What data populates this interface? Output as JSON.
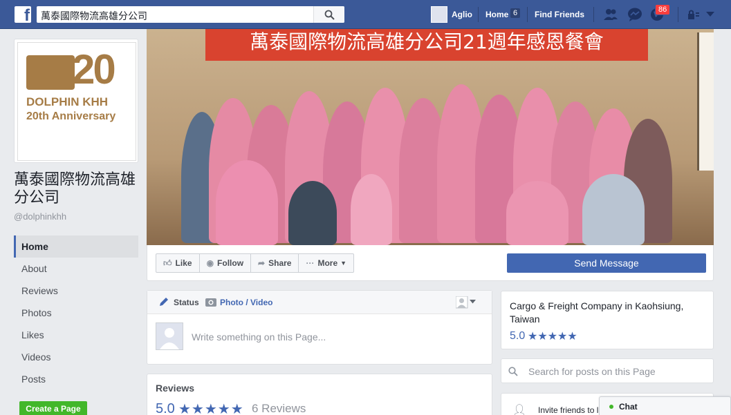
{
  "topbar": {
    "search_value": "萬泰國際物流高雄分公司",
    "user_name": "Aglio",
    "home_label": "Home",
    "home_count": "6",
    "find_friends_label": "Find Friends",
    "notifications_count": "86",
    "brand_color": "#3b5998"
  },
  "page": {
    "name": "萬泰國際物流高雄分公司",
    "handle": "@dolphinkhh",
    "logo_number": "20",
    "logo_line1": "DOLPHIN KHH",
    "logo_line2": "20th Anniversary"
  },
  "nav": {
    "items": [
      "Home",
      "About",
      "Reviews",
      "Photos",
      "Likes",
      "Videos",
      "Posts"
    ],
    "active": "Home",
    "create_page_label": "Create a Page"
  },
  "cover": {
    "banner_text": "萬泰國際物流高雄分公司21週年感恩餐會"
  },
  "actions": {
    "like_label": "Like",
    "follow_label": "Follow",
    "share_label": "Share",
    "more_label": "More",
    "send_message_label": "Send Message"
  },
  "composer": {
    "status_tab": "Status",
    "photo_tab": "Photo / Video",
    "placeholder": "Write something on this Page..."
  },
  "reviews": {
    "title": "Reviews",
    "score": "5.0",
    "stars": "★★★★★",
    "count_label": "6 Reviews"
  },
  "about": {
    "category": "Cargo & Freight Company in Kaohsiung, Taiwan",
    "score": "5.0",
    "stars": "★★★★★"
  },
  "post_search": {
    "placeholder": "Search for posts on this Page"
  },
  "invite": {
    "label": "Invite friends to l"
  },
  "chat": {
    "label": "Chat"
  }
}
